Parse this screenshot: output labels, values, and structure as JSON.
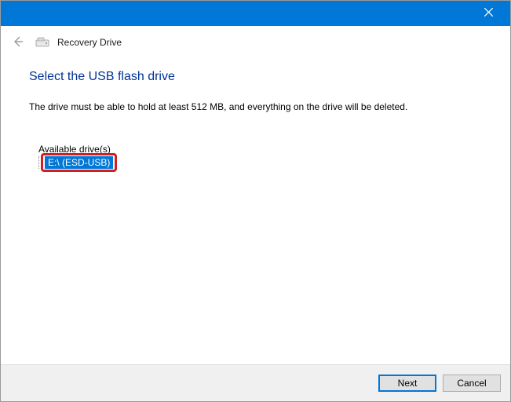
{
  "window": {
    "title": "Recovery Drive"
  },
  "page": {
    "title": "Select the USB flash drive",
    "instruction": "The drive must be able to hold at least 512 MB, and everything on the drive will be deleted."
  },
  "drives": {
    "label": "Available drive(s)",
    "items": [
      {
        "text": "E:\\ (ESD-USB)",
        "selected": true
      }
    ]
  },
  "buttons": {
    "next": "Next",
    "cancel": "Cancel"
  },
  "colors": {
    "accent": "#0178d7",
    "title_text": "#003399",
    "highlight_border": "#d1201f"
  }
}
